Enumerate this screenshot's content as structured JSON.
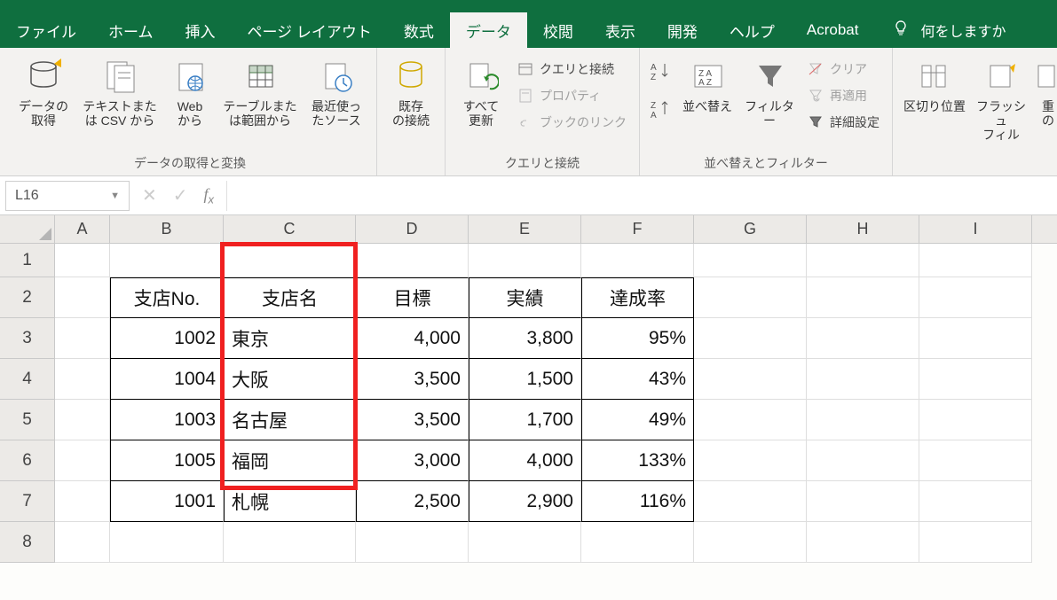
{
  "tabs": [
    "ファイル",
    "ホーム",
    "挿入",
    "ページ レイアウト",
    "数式",
    "データ",
    "校閲",
    "表示",
    "開発",
    "ヘルプ",
    "Acrobat"
  ],
  "active_tab_index": 5,
  "search_prompt": "何をしますか",
  "ribbon": {
    "g1": {
      "label": "データの取得と変換",
      "btns": [
        "データの\n取得",
        "テキストまた\nは CSV から",
        "Web\nから",
        "テーブルまた\nは範囲から",
        "最近使っ\nたソース"
      ]
    },
    "g2": {
      "label": "",
      "btns": [
        "既存\nの接続"
      ]
    },
    "g3": {
      "label": "クエリと接続",
      "main": "すべて\n更新",
      "items": [
        {
          "icon": "link",
          "t": "クエリと接続"
        },
        {
          "icon": "props",
          "t": "プロパティ"
        },
        {
          "icon": "booklink",
          "t": "ブックのリンク"
        }
      ]
    },
    "g4": {
      "label": "並べ替えとフィルター",
      "btn": "並べ替え",
      "filter": "フィルター",
      "items": [
        {
          "icon": "clear",
          "t": "クリア",
          "dim": true
        },
        {
          "icon": "reapply",
          "t": "再適用",
          "dim": true
        },
        {
          "icon": "adv",
          "t": "詳細設定"
        }
      ]
    },
    "g5": {
      "btns": [
        "区切り位置",
        "フラッシュ\nフィル",
        "重\nの"
      ]
    }
  },
  "namebox": "L16",
  "formula": "",
  "columns": [
    "A",
    "B",
    "C",
    "D",
    "E",
    "F",
    "G",
    "H",
    "I"
  ],
  "rows": [
    "1",
    "2",
    "3",
    "4",
    "5",
    "6",
    "7",
    "8"
  ],
  "table": {
    "headers": [
      "支店No.",
      "支店名",
      "目標",
      "実績",
      "達成率"
    ],
    "rows": [
      {
        "no": "1002",
        "name": "東京",
        "goal": "4,000",
        "act": "3,800",
        "rate": "95%"
      },
      {
        "no": "1004",
        "name": "大阪",
        "goal": "3,500",
        "act": "1,500",
        "rate": "43%"
      },
      {
        "no": "1003",
        "name": "名古屋",
        "goal": "3,500",
        "act": "1,700",
        "rate": "49%"
      },
      {
        "no": "1005",
        "name": "福岡",
        "goal": "3,000",
        "act": "4,000",
        "rate": "133%"
      },
      {
        "no": "1001",
        "name": "札幌",
        "goal": "2,500",
        "act": "2,900",
        "rate": "116%"
      }
    ]
  },
  "chart_data": {
    "type": "table",
    "headers": [
      "支店No.",
      "支店名",
      "目標",
      "実績",
      "達成率"
    ],
    "rows": [
      [
        1002,
        "東京",
        4000,
        3800,
        0.95
      ],
      [
        1004,
        "大阪",
        3500,
        1500,
        0.43
      ],
      [
        1003,
        "名古屋",
        3500,
        1700,
        0.49
      ],
      [
        1005,
        "福岡",
        3000,
        4000,
        1.33
      ],
      [
        1001,
        "札幌",
        2500,
        2900,
        1.16
      ]
    ]
  }
}
